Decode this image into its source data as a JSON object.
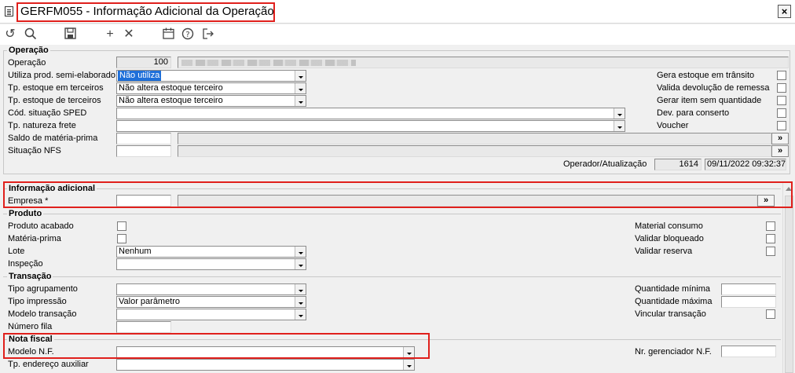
{
  "window": {
    "title": "GERFM055 - Informação Adicional da Operação",
    "close_label": "×"
  },
  "toolbar": {
    "icons": [
      "undo-icon",
      "search-icon",
      "save-icon",
      "plus-icon",
      "cancel-icon",
      "calendar-icon",
      "help-icon",
      "exit-icon"
    ]
  },
  "operacao": {
    "title": "Operação",
    "operacao_label": "Operação",
    "operacao_value": "100",
    "utiliza_label": "Utiliza prod. semi-elaborado",
    "utiliza_value": "Não utiliza",
    "tp_estoque_em_label": "Tp. estoque em terceiros",
    "tp_estoque_em_value": "Não altera estoque terceiro",
    "tp_estoque_de_label": "Tp. estoque de terceiros",
    "tp_estoque_de_value": "Não altera estoque terceiro",
    "cod_sped_label": "Cód. situação SPED",
    "natureza_label": "Tp. natureza frete",
    "saldo_label": "Saldo de matéria-prima",
    "situacao_label": "Situação NFS",
    "btn_label": "»",
    "gera_estoque_label": "Gera estoque em trânsito",
    "valida_devolucao_label": "Valida devolução de remessa",
    "gerar_item_label": "Gerar item sem quantidade",
    "dev_conserto_label": "Dev. para conserto",
    "voucher_label": "Voucher",
    "operador_label": "Operador/Atualização",
    "operador_value": "1614",
    "atualizacao_value": "09/11/2022 09:32:37"
  },
  "info_adicional": {
    "title": "Informação adicional",
    "empresa_label": "Empresa *",
    "btn_label": "»"
  },
  "produto": {
    "title": "Produto",
    "produto_acabado_label": "Produto acabado",
    "materia_prima_label": "Matéria-prima",
    "lote_label": "Lote",
    "lote_value": "Nenhum",
    "inspecao_label": "Inspeção",
    "material_consumo_label": "Material consumo",
    "validar_bloqueado_label": "Validar bloqueado",
    "validar_reserva_label": "Validar reserva"
  },
  "transacao": {
    "title": "Transação",
    "tipo_agrupamento_label": "Tipo agrupamento",
    "tipo_impressao_label": "Tipo impressão",
    "tipo_impressao_value": "Valor parâmetro",
    "modelo_transacao_label": "Modelo transação",
    "numero_fila_label": "Número fila",
    "qtd_minima_label": "Quantidade mínima",
    "qtd_maxima_label": "Quantidade máxima",
    "vincular_label": "Vincular transação"
  },
  "nota_fiscal": {
    "title": "Nota fiscal",
    "modelo_nf_label": "Modelo N.F.",
    "tp_endereco_label": "Tp. endereço auxiliar",
    "nr_gerenciador_label": "Nr. gerenciador N.F."
  }
}
